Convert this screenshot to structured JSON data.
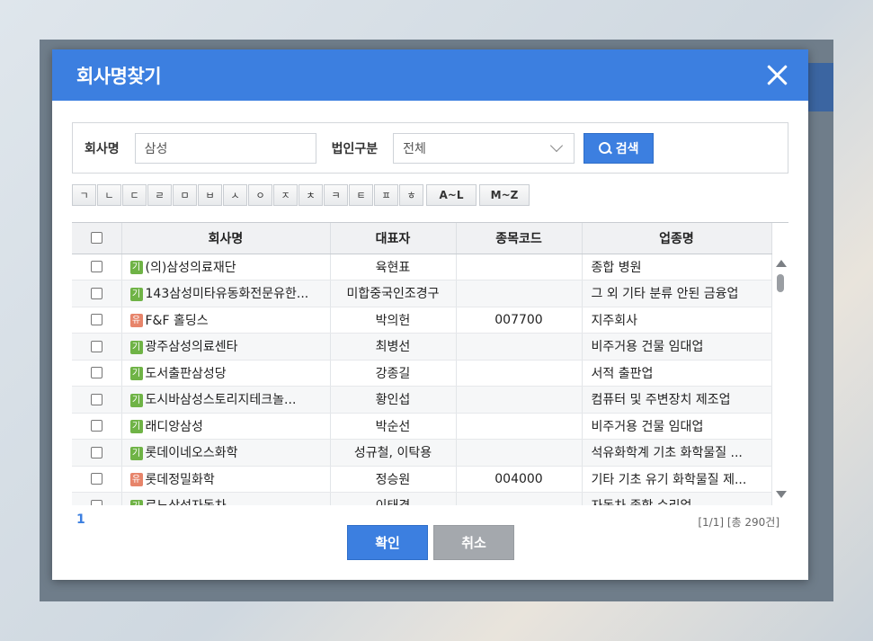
{
  "modal": {
    "title": "회사명찾기",
    "close_icon": "close-icon"
  },
  "search": {
    "company_label": "회사명",
    "company_value": "삼성",
    "corp_type_label": "법인구분",
    "corp_type_value": "전체",
    "search_button": "검색"
  },
  "alphabet": [
    "ㄱ",
    "ㄴ",
    "ㄷ",
    "ㄹ",
    "ㅁ",
    "ㅂ",
    "ㅅ",
    "ㅇ",
    "ㅈ",
    "ㅊ",
    "ㅋ",
    "ㅌ",
    "ㅍ",
    "ㅎ",
    "A~L",
    "M~Z"
  ],
  "table": {
    "headers": [
      "회사명",
      "대표자",
      "종목코드",
      "업종명"
    ],
    "rows": [
      {
        "badge": "기",
        "name": "(의)삼성의료재단",
        "ceo": "육현표",
        "code": "",
        "industry": "종합 병원"
      },
      {
        "badge": "기",
        "name": "143삼성미타유동화전문유한...",
        "ceo": "미합중국인조경구",
        "code": "",
        "industry": "그 외 기타 분류 안된 금융업"
      },
      {
        "badge": "유",
        "name": "F&F 홀딩스",
        "ceo": "박의헌",
        "code": "007700",
        "industry": "지주회사"
      },
      {
        "badge": "기",
        "name": "광주삼성의료센타",
        "ceo": "최병선",
        "code": "",
        "industry": "비주거용 건물 임대업"
      },
      {
        "badge": "기",
        "name": "도서출판삼성당",
        "ceo": "강종길",
        "code": "",
        "industry": "서적 출판업"
      },
      {
        "badge": "기",
        "name": "도시바삼성스토리지테크놀...",
        "ceo": "황인섭",
        "code": "",
        "industry": "컴퓨터 및 주변장치 제조업"
      },
      {
        "badge": "기",
        "name": "래디앙삼성",
        "ceo": "박순선",
        "code": "",
        "industry": "비주거용 건물 임대업"
      },
      {
        "badge": "기",
        "name": "롯데이네오스화학",
        "ceo": "성규철, 이탁용",
        "code": "",
        "industry": "석유화학계 기초 화학물질 ..."
      },
      {
        "badge": "유",
        "name": "롯데정밀화학",
        "ceo": "정승원",
        "code": "004000",
        "industry": "기타 기초 유기 화학물질 제..."
      },
      {
        "badge": "기",
        "name": "르노삼성자동차",
        "ceo": "이태경",
        "code": "",
        "industry": "자동차 종합 수리업"
      }
    ]
  },
  "pagination": {
    "current_page": "1",
    "summary": "[1/1] [총 290건]"
  },
  "buttons": {
    "ok": "확인",
    "cancel": "취소"
  }
}
